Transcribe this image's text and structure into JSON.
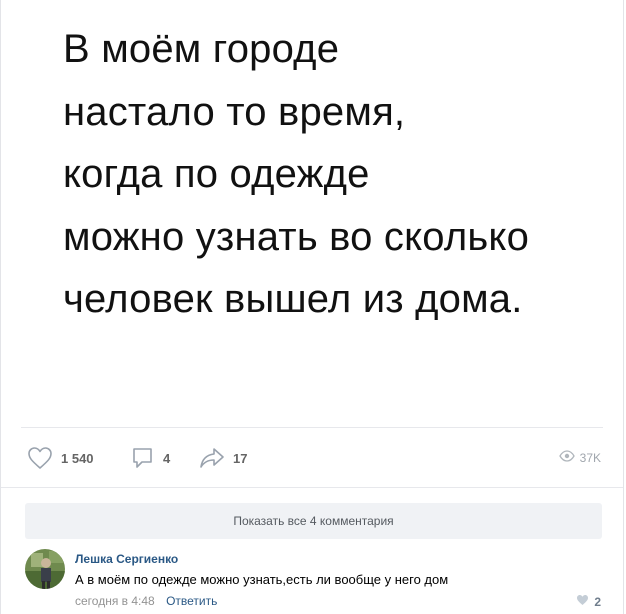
{
  "post": {
    "meme_lines": [
      "В моём городе",
      "настало то время,",
      "когда по одежде",
      "можно узнать во сколько",
      "человек вышел из дома."
    ],
    "likes": "1 540",
    "comments": "4",
    "shares": "17",
    "views": "37K"
  },
  "icons": {
    "like": "heart-icon",
    "comment": "comment-icon",
    "share": "share-arrow-icon",
    "views": "eye-icon"
  },
  "colors": {
    "link": "#2a5885",
    "muted": "#939393",
    "button_bg": "#f0f2f5"
  },
  "comments_section": {
    "show_all_label": "Показать все 4 комментария",
    "items": [
      {
        "author": "Лешка Сергиенко",
        "text": "А в моём по одежде можно узнать,есть ли вообще у него дом",
        "time": "сегодня в 4:48",
        "reply_label": "Ответить",
        "likes": "2"
      }
    ]
  }
}
